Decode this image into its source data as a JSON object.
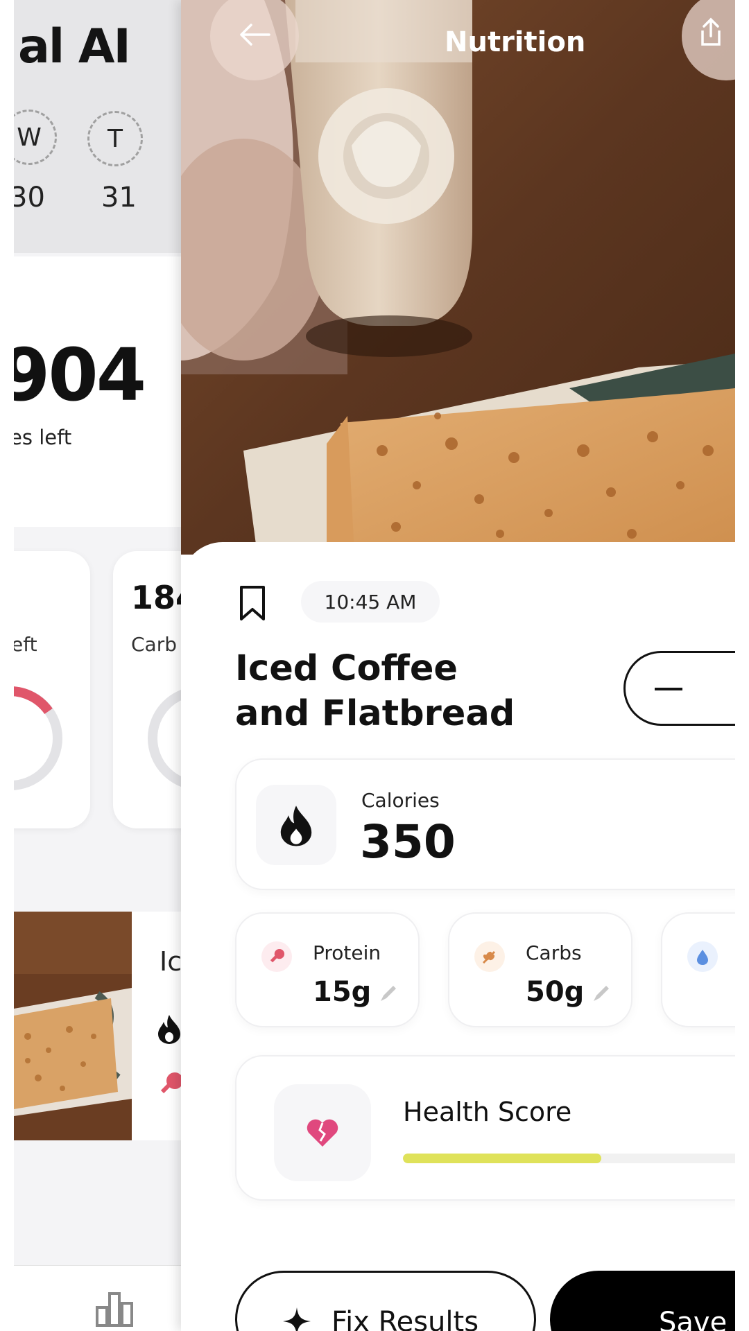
{
  "background_app": {
    "title_fragment": "al AI",
    "days": [
      {
        "letter": "W",
        "number": "30"
      },
      {
        "letter": "T",
        "number": "31"
      }
    ],
    "calories_left_value": "904",
    "calories_left_label": "ies left",
    "macro_cards": [
      {
        "value": "",
        "label": "eft"
      },
      {
        "value": "184",
        "label": "Carb"
      }
    ],
    "recent_item_title": "Ic"
  },
  "nutrition": {
    "header": {
      "title": "Nutrition",
      "back_icon": "arrow-left-icon",
      "share_icon": "share-icon"
    },
    "time": "10:45 AM",
    "meal_name": "Iced Coffee and Flatbread",
    "quantity_stepper": {
      "minus_icon": "minus-icon"
    },
    "calories": {
      "label": "Calories",
      "value": "350",
      "icon": "flame-icon"
    },
    "macros": [
      {
        "label": "Protein",
        "value": "15g",
        "icon": "drumstick-icon",
        "color": "#e0566a"
      },
      {
        "label": "Carbs",
        "value": "50g",
        "icon": "wheat-icon",
        "color": "#d88a4a"
      },
      {
        "label": "",
        "value": "",
        "icon": "fat-drop-icon",
        "color": "#5b8fe0"
      }
    ],
    "health_score": {
      "label": "Health Score",
      "progress": 0.55,
      "bar_color": "#dfe25a",
      "icon": "broken-heart-icon",
      "icon_color": "#e0487e"
    },
    "actions": {
      "fix_label": "Fix Results",
      "save_label": "Save"
    }
  }
}
